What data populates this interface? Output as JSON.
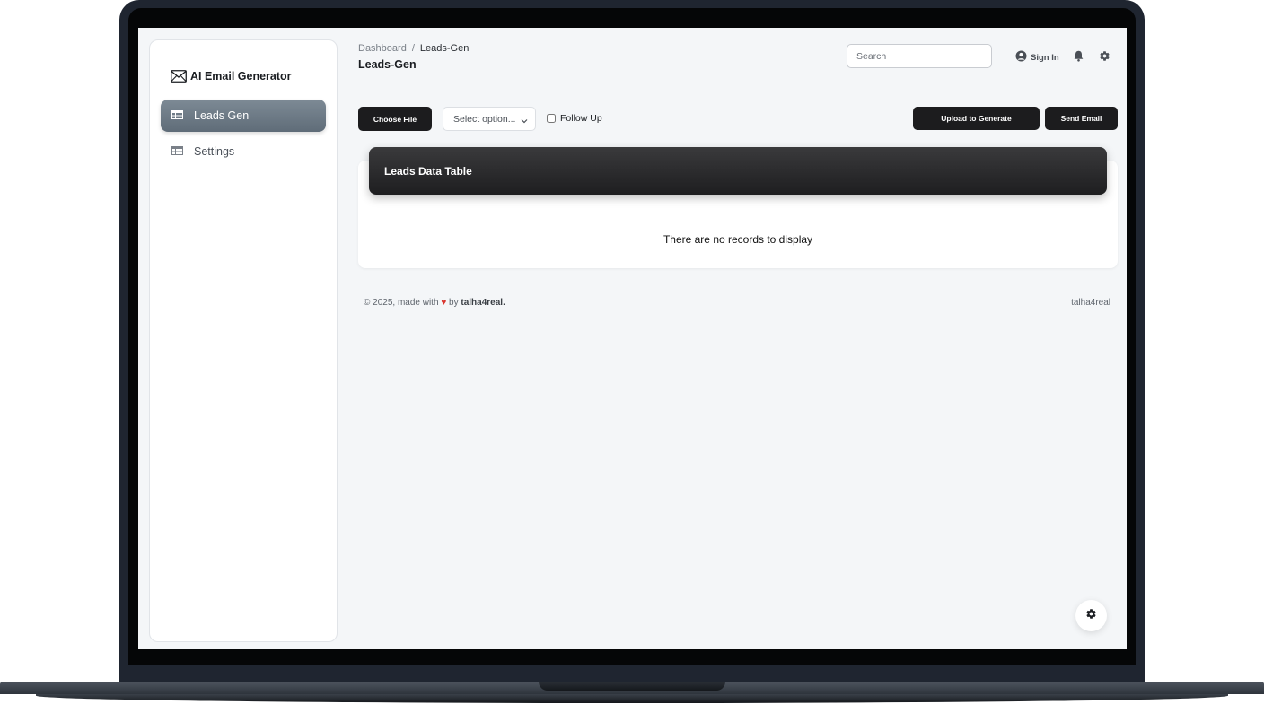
{
  "brand": {
    "name": "AI Email Generator"
  },
  "sidebar": {
    "items": [
      {
        "label": "Leads Gen",
        "icon": "table-icon",
        "active": true
      },
      {
        "label": "Settings",
        "icon": "table-icon",
        "active": false
      }
    ]
  },
  "header": {
    "breadcrumb": {
      "root": "Dashboard",
      "separator": "/",
      "current": "Leads-Gen"
    },
    "title": "Leads-Gen",
    "search_placeholder": "Search",
    "signin_label": "Sign In"
  },
  "toolbar": {
    "choose_file_label": "Choose File",
    "select_placeholder": "Select option...",
    "follow_up_label": "Follow Up",
    "follow_up_checked": false,
    "upload_label": "Upload to Generate",
    "send_label": "Send Email"
  },
  "table": {
    "title": "Leads Data Table",
    "empty_message": "There are no records to display"
  },
  "footer": {
    "copyright": "© 2025, made with",
    "by": "by",
    "author": "talha4real.",
    "right_link": "talha4real"
  },
  "colors": {
    "active_nav": "#6f7c88",
    "dark_button": "#1c1c1e",
    "heart": "#d9352f",
    "background": "#f4f6f8"
  }
}
